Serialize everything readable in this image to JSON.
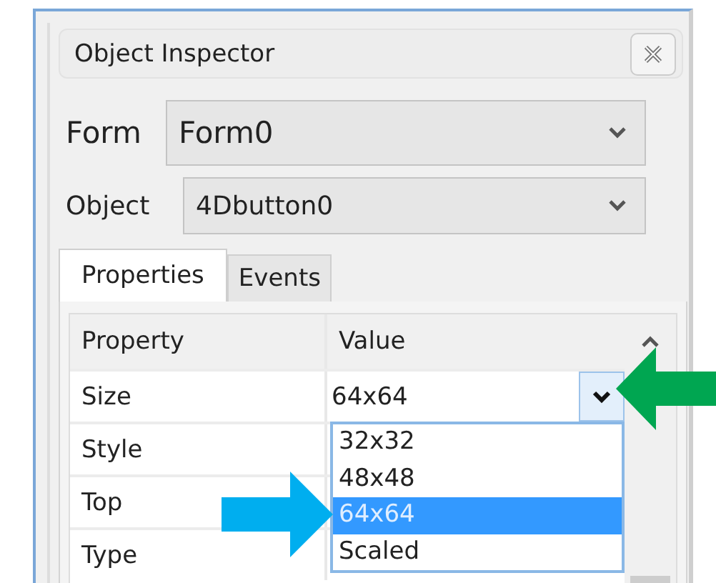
{
  "panel": {
    "title": "Object Inspector"
  },
  "form": {
    "label": "Form",
    "value": "Form0"
  },
  "object": {
    "label": "Object",
    "value": "4Dbutton0"
  },
  "tabs": [
    {
      "label": "Properties",
      "selected": true
    },
    {
      "label": "Events",
      "selected": false
    }
  ],
  "grid": {
    "columns": [
      "Property",
      "Value"
    ],
    "rows": [
      {
        "property": "Size",
        "value": "64x64",
        "open": true
      },
      {
        "property": "Style"
      },
      {
        "property": "Top"
      },
      {
        "property": "Type"
      }
    ],
    "options": [
      {
        "label": "32x32",
        "selected": false
      },
      {
        "label": "48x48",
        "selected": false
      },
      {
        "label": "64x64",
        "selected": true
      },
      {
        "label": "Scaled",
        "selected": false
      }
    ]
  }
}
